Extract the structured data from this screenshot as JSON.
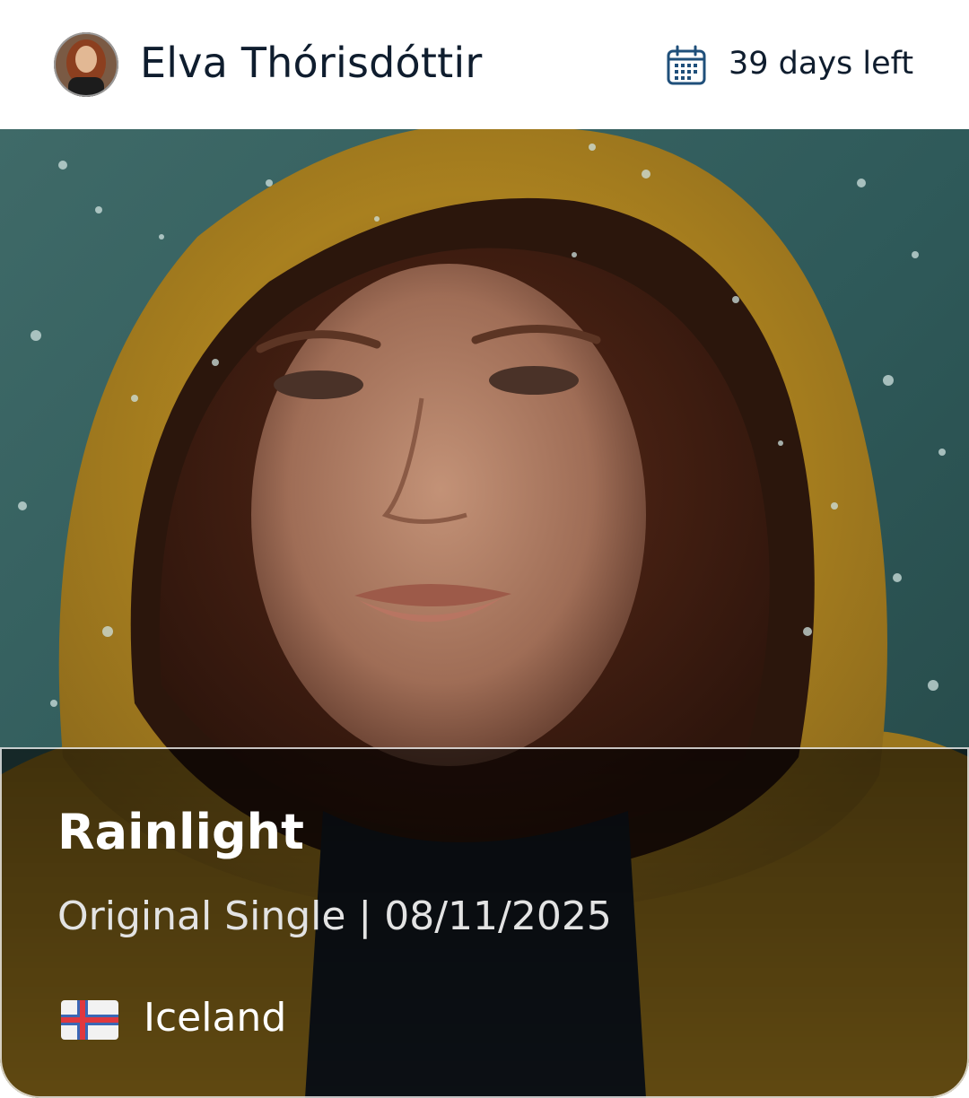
{
  "header": {
    "user_name": "Elva Thórisdóttir",
    "days_left": "39 days left",
    "calendar_icon": "calendar-icon",
    "avatar_icon": "avatar"
  },
  "release": {
    "title": "Rainlight",
    "meta": "Original Single | 08/11/2025",
    "country": "Iceland",
    "flag_icon": "iceland-flag-icon"
  },
  "colors": {
    "text_dark": "#0f1d2e",
    "calendar_blue": "#1f4f7a",
    "raincoat_yellow": "#b98a1f"
  }
}
